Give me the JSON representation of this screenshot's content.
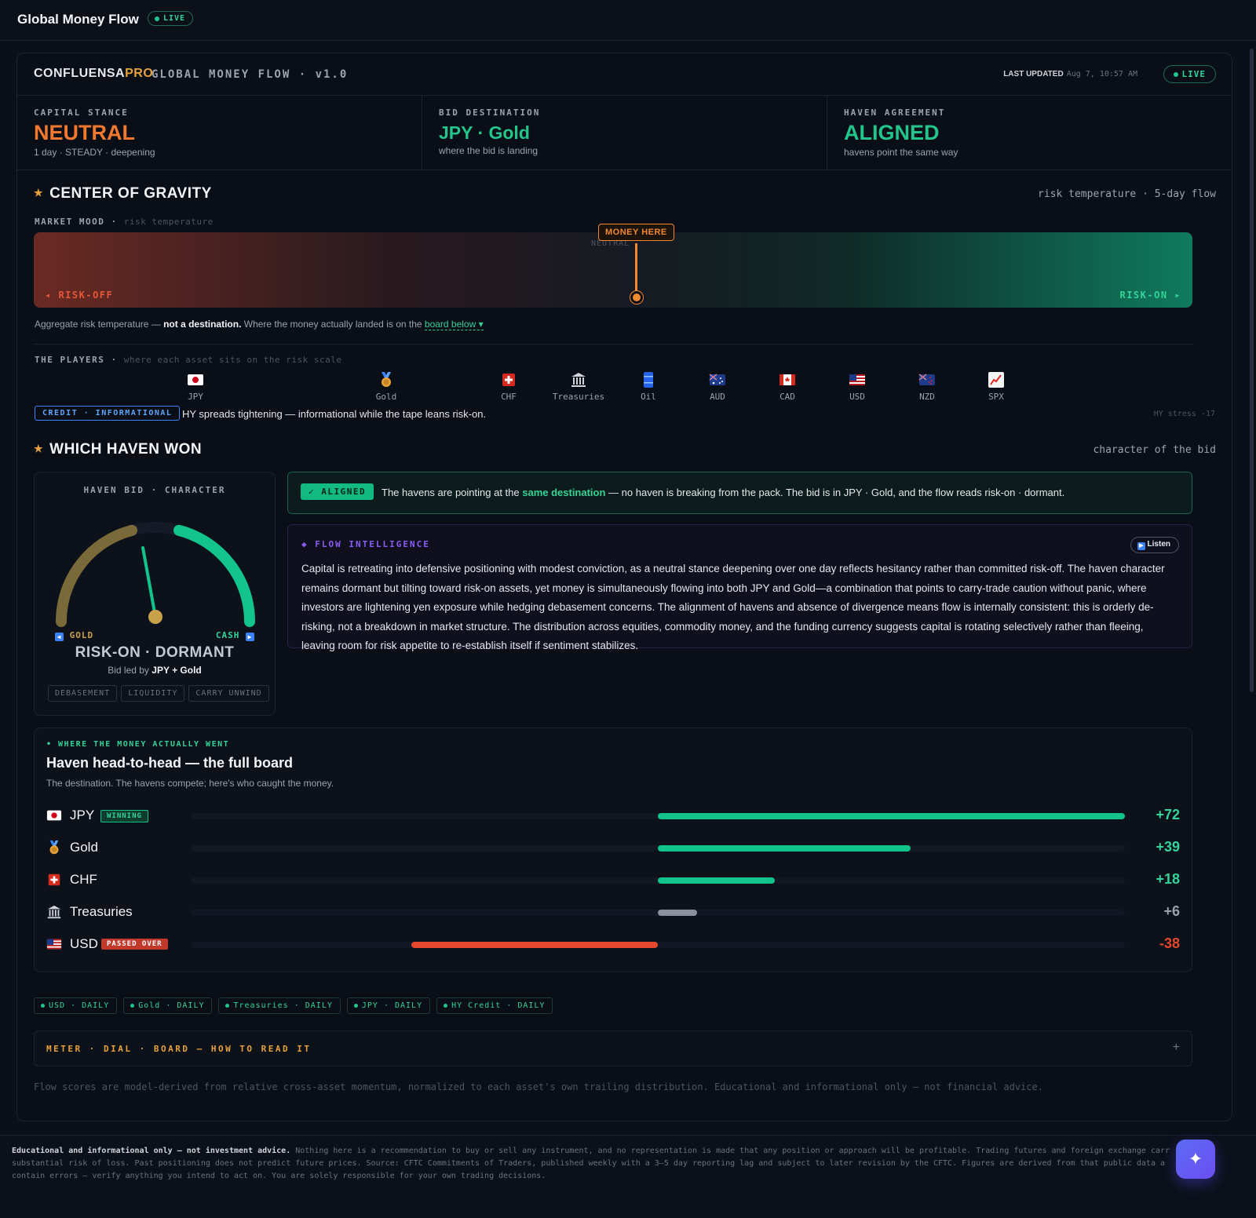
{
  "app": {
    "title": "Global Money Flow",
    "live_label": "LIVE"
  },
  "header": {
    "brand_main": "CONFLUENSA",
    "brand_pro": "PRO",
    "brand_sub": "GLOBAL MONEY FLOW · v1.0",
    "last_updated_label": "LAST UPDATED",
    "last_updated_value": "Aug 7, 10:57 AM",
    "live_label": "LIVE"
  },
  "stats": [
    {
      "label": "CAPITAL STANCE",
      "value": "NEUTRAL",
      "sub": "1 day · STEADY · deepening",
      "color": "#f0782f"
    },
    {
      "label": "BID DESTINATION",
      "value": "JPY · Gold",
      "sub": "where the bid is landing",
      "color": "#22c58b"
    },
    {
      "label": "HAVEN AGREEMENT",
      "value": "ALIGNED",
      "sub": "havens point the same way",
      "color": "#22c58b"
    }
  ],
  "gravity": {
    "title": "CENTER OF GRAVITY",
    "right": "risk temperature · 5-day flow",
    "mood_label": "MARKET MOOD",
    "mood_dim": "risk temperature",
    "money_here": "MONEY HERE",
    "neutral": "NEUTRAL",
    "risk_off": "◂ RISK-OFF",
    "risk_on": "RISK-ON ▸",
    "needle_position": 0.52,
    "agg_pre": "Aggregate risk temperature — ",
    "agg_bold": "not a destination.",
    "agg_mid": " Where the money actually landed is on the ",
    "agg_link": "board below ▾"
  },
  "players": {
    "label": "THE PLAYERS",
    "dim": "where each asset sits on the risk scale",
    "items": [
      {
        "name": "JPY",
        "icon": "jp-flag-icon"
      },
      {
        "name": "Gold",
        "icon": "gold-medal-icon"
      },
      {
        "name": "CHF",
        "icon": "ch-flag-icon"
      },
      {
        "name": "Treasuries",
        "icon": "bank-icon"
      },
      {
        "name": "Oil",
        "icon": "oil-barrel-icon"
      },
      {
        "name": "AUD",
        "icon": "au-flag-icon"
      },
      {
        "name": "CAD",
        "icon": "ca-flag-icon"
      },
      {
        "name": "USD",
        "icon": "us-flag-icon"
      },
      {
        "name": "NZD",
        "icon": "nz-flag-icon"
      },
      {
        "name": "SPX",
        "icon": "chart-up-icon"
      }
    ],
    "credit_tag": "CREDIT · INFORMATIONAL",
    "credit_text": "HY spreads tightening — informational while the tape leans risk-on.",
    "hy_stress": "HY stress -17"
  },
  "haven": {
    "title": "WHICH HAVEN WON",
    "right": "character of the bid",
    "dial_header": "HAVEN BID · CHARACTER",
    "gold_label": "GOLD",
    "cash_label": "CASH",
    "state": "RISK-ON · DORMANT",
    "led_pre": "Bid led by ",
    "led_bold": "JPY + Gold",
    "chips": [
      "DEBASEMENT",
      "LIQUIDITY",
      "CARRY UNWIND"
    ],
    "aligned_tag": "✓ ALIGNED",
    "aligned_pre": "The havens are pointing at the ",
    "aligned_hl": "same destination",
    "aligned_post": " — no haven is breaking from the pack. The bid is in JPY · Gold, and the flow reads risk-on · dormant.",
    "intel_header": "◆ FLOW INTELLIGENCE",
    "listen": "Listen",
    "intel_body": "Capital is retreating into defensive positioning with modest conviction, as a neutral stance deepening over one day reflects hesitancy rather than committed risk-off. The haven character remains dormant but tilting toward risk-on assets, yet money is simultaneously flowing into both JPY and Gold—a combination that points to carry-trade caution without panic, where investors are lightening yen exposure while hedging debasement concerns. The alignment of havens and absence of divergence means flow is internally consistent: this is orderly de-risking, not a breakdown in market structure. The distribution across equities, commodity money, and the funding currency suggests capital is rotating selectively rather than fleeing, leaving room for risk appetite to re-establish itself if sentiment stabilizes."
  },
  "board": {
    "kicker": "• WHERE THE MONEY ACTUALLY WENT",
    "title": "Haven head-to-head — the full board",
    "sub": "The destination. The havens compete; here's who caught the money.",
    "rows": [
      {
        "name": "JPY",
        "icon": "jp-flag-icon",
        "badge": "WINNING",
        "value": 72,
        "label": "+72",
        "color": "#12c48b"
      },
      {
        "name": "Gold",
        "icon": "gold-medal-icon",
        "badge": "",
        "value": 39,
        "label": "+39",
        "color": "#12c48b"
      },
      {
        "name": "CHF",
        "icon": "ch-flag-icon",
        "badge": "",
        "value": 18,
        "label": "+18",
        "color": "#12c48b"
      },
      {
        "name": "Treasuries",
        "icon": "bank-icon",
        "badge": "",
        "value": 6,
        "label": "+6",
        "color": "#8b919c"
      },
      {
        "name": "USD",
        "icon": "us-flag-icon",
        "badge": "PASSED OVER",
        "value": -38,
        "label": "-38",
        "color": "#e5472c"
      }
    ]
  },
  "feeds": [
    "USD · DAILY",
    "Gold · DAILY",
    "Treasuries · DAILY",
    "JPY · DAILY",
    "HY Credit · DAILY"
  ],
  "howto": {
    "title": "METER · DIAL · BOARD — HOW TO READ IT",
    "toggle": "+"
  },
  "disclaimer_short": "Flow scores are model-derived from relative cross-asset momentum, normalized to each asset's own trailing distribution. Educational and informational only — not financial advice.",
  "footer": {
    "bold": "Educational and informational only — not investment advice.",
    "line1": " Nothing here is a recommendation to buy or sell any instrument, and no representation is made that any position or approach will be profitable. Trading futures and foreign exchange carr",
    "line2": "substantial risk of loss. Past positioning does not predict future prices. Source: CFTC Commitments of Traders, published weekly with a 3–5 day reporting lag and subject to later revision by the CFTC. Figures are derived from that public data a",
    "line3": "contain errors — verify anything you intend to act on. You are solely responsible for your own trading decisions."
  },
  "fab_icon": "sparkle-icon"
}
